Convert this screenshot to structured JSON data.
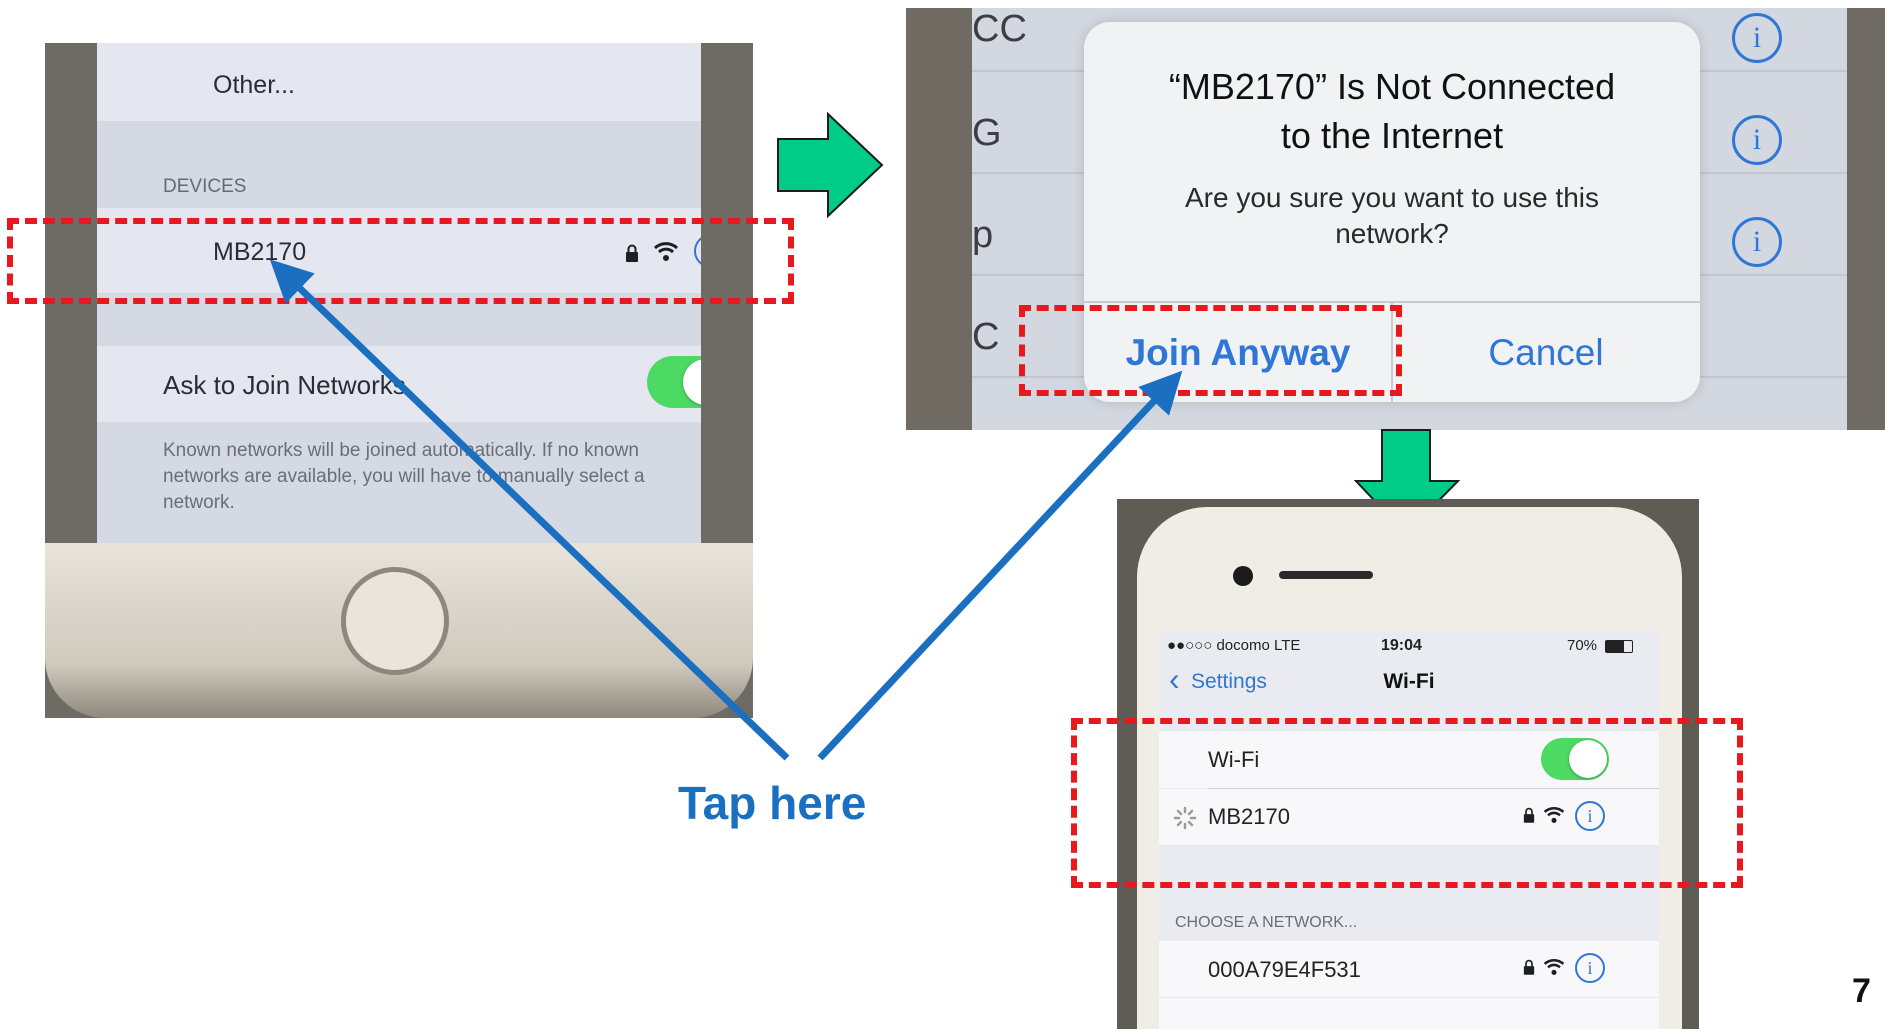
{
  "photo1": {
    "other_label": "Other...",
    "devices_header": "DEVICES",
    "network_name": "MB2170",
    "ask_join_label": "Ask to Join Networks",
    "ask_join_line1": "Known networks will be joined automatically. If no known",
    "ask_join_line2": "networks are available, you will have to manually select a",
    "ask_join_line3": "network."
  },
  "photo2": {
    "bg_letters": [
      "CC",
      "G",
      "p",
      "C"
    ],
    "alert_title_line1": "“MB2170” Is Not Connected",
    "alert_title_line2": "to the Internet",
    "alert_message_line1": "Are you sure you want to use this",
    "alert_message_line2": "network?",
    "join_anyway_label": "Join Anyway",
    "cancel_label": "Cancel"
  },
  "photo3": {
    "carrier": "●●○○○ docomo  LTE",
    "time": "19:04",
    "battery": "70%",
    "back_label": "Settings",
    "nav_title": "Wi-Fi",
    "wifi_label": "Wi-Fi",
    "connecting_network": "MB2170",
    "choose_header": "CHOOSE A NETWORK...",
    "other_network": "000A79E4F531"
  },
  "annotation": {
    "tap_here": "Tap here",
    "page_number": "7"
  },
  "colors": {
    "highlight_red": "#e8191c",
    "arrow_blue": "#1a6fc0",
    "step_green": "#00cc88",
    "ios_blue": "#2f77d6",
    "toggle_green": "#4cd964"
  }
}
